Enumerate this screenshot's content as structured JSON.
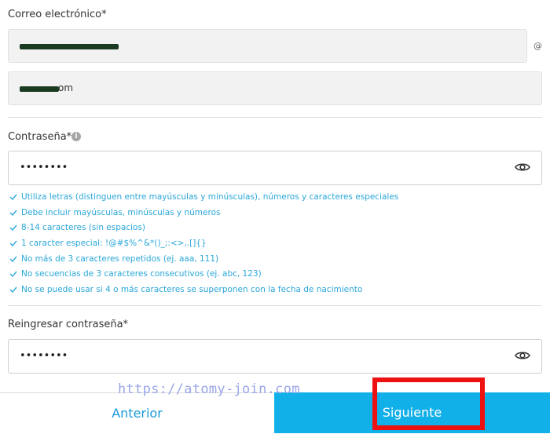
{
  "email": {
    "label": "Correo electrónico*",
    "at_symbol": "@",
    "domain_suffix": "om"
  },
  "password": {
    "label": "Contraseña*",
    "info_glyph": "i",
    "mask": "••••••••",
    "eye_icon": "eye-icon"
  },
  "rules": [
    "Utiliza letras (distinguen entre mayúsculas y minúsculas), números y caracteres especiales",
    "Debe incluir mayúsculas, minúsculas y números",
    "8-14 caracteres (sin espacios)",
    "1 caracter especial: !@#$%^&*()_;:<>,.[]{}",
    "No más de 3 caracteres repetidos (ej. aaa, 111)",
    "No secuencias de 3 caracteres consecutivos (ej. abc, 123)",
    "No se puede usar si 4 o más caracteres se superponen con la fecha de nacimiento"
  ],
  "confirm_password": {
    "label": "Reingresar contraseña*",
    "mask": "••••••••",
    "eye_icon": "eye-icon"
  },
  "buttons": {
    "prev": "Anterior",
    "next": "Siguiente"
  },
  "watermark": "https://atomy-join.com",
  "colors": {
    "accent": "#12b0e8",
    "rule_text": "#2aa7d9",
    "highlight": "#ee1111"
  }
}
